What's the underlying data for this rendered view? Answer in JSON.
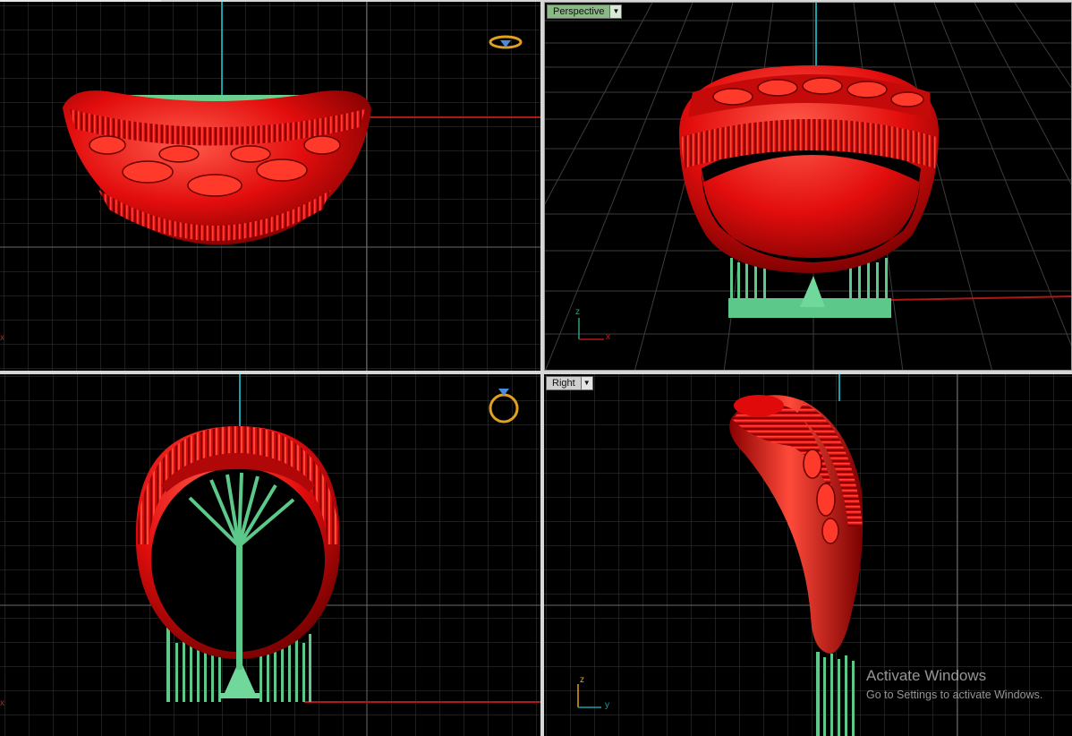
{
  "viewports": {
    "top": {
      "label": ""
    },
    "perspective": {
      "label": "Perspective",
      "active": true
    },
    "front": {
      "label": ""
    },
    "right": {
      "label": "Right"
    }
  },
  "axis_labels": {
    "perspective": {
      "z": "z",
      "x": "x"
    },
    "right": {
      "z": "z",
      "y": "y"
    },
    "top_origin_marker": "x",
    "front_origin_marker": "x"
  },
  "icons": {
    "ring_gizmo_top": "ring-gizmo-icon",
    "ring_gizmo_front": "ring-gizmo-icon"
  },
  "watermark": {
    "title": "Activate Windows",
    "subtitle": "Go to Settings to activate Windows."
  },
  "colors": {
    "background": "#000000",
    "grid": "#3a3a3a",
    "grid_major": "#6a6a6a",
    "axis_x": "#b01818",
    "axis_y": "#1aa0a8",
    "ring_red": "#e20d0d",
    "support_green": "#5cc98a",
    "tab_active": "#8ab986",
    "tab_inactive": "#cfcfcf"
  }
}
